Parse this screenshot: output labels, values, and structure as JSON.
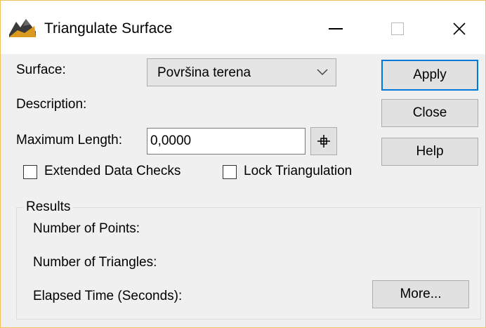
{
  "window": {
    "title": "Triangulate Surface",
    "icon": "terrain-surface-icon",
    "controls": {
      "minimize": "minimize-icon",
      "maximize": "maximize-icon",
      "close": "close-icon"
    }
  },
  "form": {
    "surface_label": "Surface:",
    "surface_value": "Površina terena",
    "description_label": "Description:",
    "max_length_label": "Maximum Length:",
    "max_length_value": "0,0000",
    "pick_icon": "crosshair-icon",
    "extended_checks_label": "Extended Data Checks",
    "extended_checks_checked": false,
    "lock_triangulation_label": "Lock Triangulation",
    "lock_triangulation_checked": false
  },
  "buttons": {
    "apply": "Apply",
    "close": "Close",
    "help": "Help",
    "more": "More..."
  },
  "results": {
    "legend": "Results",
    "points_label": "Number of Points:",
    "triangles_label": "Number of Triangles:",
    "elapsed_label": "Elapsed Time (Seconds):"
  },
  "colors": {
    "window_border": "#f2c15a",
    "focus_accent": "#0078d7",
    "dialog_bg": "#f0f0f0"
  }
}
